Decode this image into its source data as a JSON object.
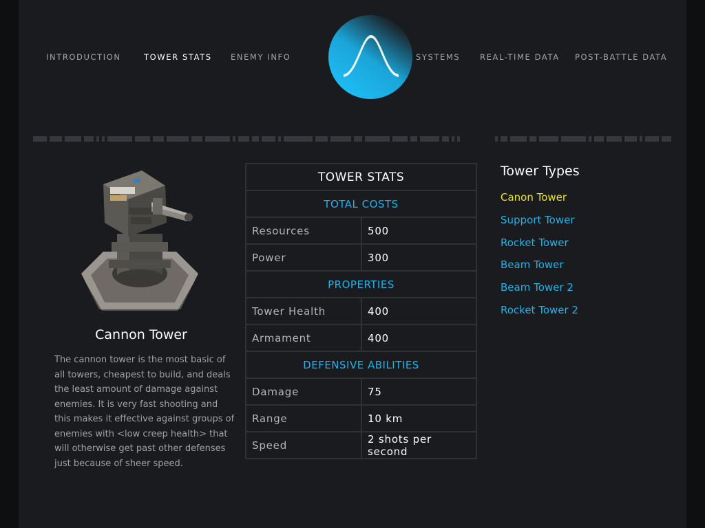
{
  "nav": {
    "left": [
      "INTRODUCTION",
      "TOWER STATS",
      "ENEMY INFO"
    ],
    "right": [
      "SYSTEMS",
      "REAL-TIME DATA",
      "POST-BATTLE DATA"
    ],
    "active": "TOWER STATS"
  },
  "logo": {
    "icon": "bell-curve-logo-icon",
    "color": "#1fb6ee"
  },
  "tower": {
    "name": "Cannon Tower",
    "description": "The cannon tower is the most basic of all towers, cheapest to build, and deals the least amount of damage against enemies. It is very fast shooting and this makes it effective against groups of enemies with <low creep health> that will otherwise get past other defenses just because of sheer speed."
  },
  "stats": {
    "title": "TOWER STATS",
    "total_costs": {
      "label": "TOTAL COSTS",
      "rows": [
        {
          "key": "Resources",
          "value": "500"
        },
        {
          "key": "Power",
          "value": "300"
        }
      ]
    },
    "properties": {
      "label": "PROPERTIES",
      "rows": [
        {
          "key": "Tower Health",
          "value": "400"
        },
        {
          "key": "Armament",
          "value": "400"
        }
      ]
    },
    "defensive": {
      "label": "DEFENSIVE ABILITIES",
      "rows": [
        {
          "key": "Damage",
          "value": "75"
        },
        {
          "key": "Range",
          "value": "10 km"
        },
        {
          "key": "Speed",
          "value": "2 shots per second"
        }
      ]
    }
  },
  "tower_types": {
    "title": "Tower Types",
    "items": [
      "Canon Tower",
      "Support Tower",
      "Rocket Tower",
      "Beam Tower",
      "Beam Tower 2",
      "Rocket Tower 2"
    ],
    "selected": "Canon Tower"
  },
  "colors": {
    "accent": "#21b3ea",
    "selected": "#e9e41e",
    "background": "#1a1b1e"
  }
}
